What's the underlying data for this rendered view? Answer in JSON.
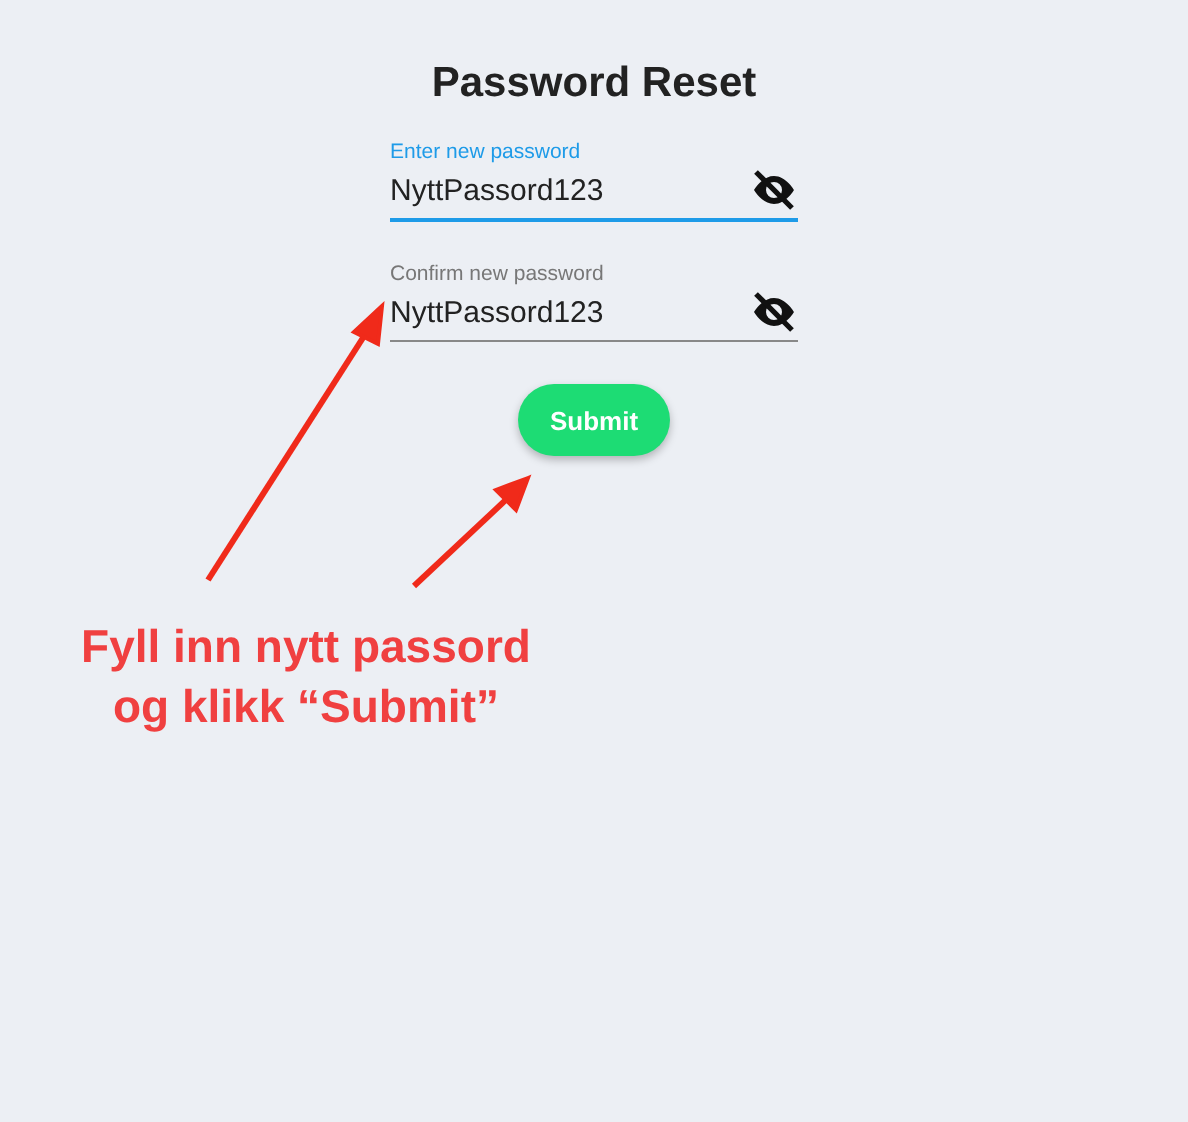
{
  "title": "Password Reset",
  "fields": [
    {
      "label": "Enter new password",
      "value": "NyttPassord123",
      "focused": true
    },
    {
      "label": "Confirm new password",
      "value": "NyttPassord123",
      "focused": false
    }
  ],
  "submit_button": "Submit",
  "annotation": {
    "text": "Fyll inn nytt passord\nog klikk “Submit”"
  }
}
